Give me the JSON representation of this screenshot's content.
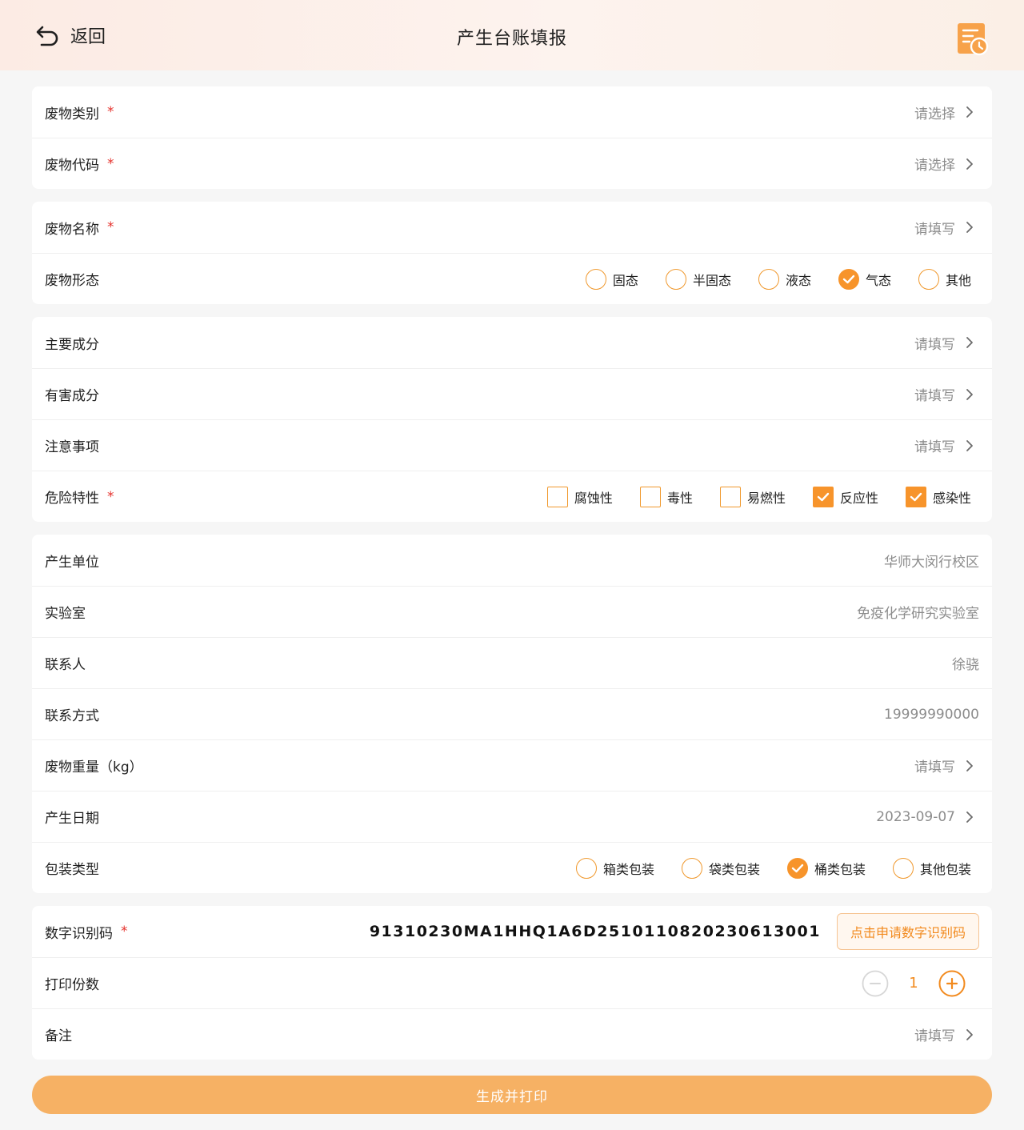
{
  "header": {
    "back_label": "返回",
    "title": "产生台账填报",
    "history_icon": "history-icon"
  },
  "group1": {
    "category": {
      "label": "废物类别",
      "required": "*",
      "placeholder": "请选择"
    },
    "code": {
      "label": "废物代码",
      "required": "*",
      "placeholder": "请选择"
    }
  },
  "group2": {
    "name": {
      "label": "废物名称",
      "required": "*",
      "placeholder": "请填写"
    },
    "form": {
      "label": "废物形态",
      "options": [
        {
          "label": "固态",
          "checked": false
        },
        {
          "label": "半固态",
          "checked": false
        },
        {
          "label": "液态",
          "checked": false
        },
        {
          "label": "气态",
          "checked": true
        },
        {
          "label": "其他",
          "checked": false
        }
      ]
    }
  },
  "group3": {
    "main_components": {
      "label": "主要成分",
      "placeholder": "请填写"
    },
    "harmful_components": {
      "label": "有害成分",
      "placeholder": "请填写"
    },
    "notes": {
      "label": "注意事项",
      "placeholder": "请填写"
    },
    "hazard": {
      "label": "危险特性",
      "required": "*",
      "options": [
        {
          "label": "腐蚀性",
          "checked": false
        },
        {
          "label": "毒性",
          "checked": false
        },
        {
          "label": "易燃性",
          "checked": false
        },
        {
          "label": "反应性",
          "checked": true
        },
        {
          "label": "感染性",
          "checked": true
        }
      ]
    }
  },
  "group4": {
    "unit": {
      "label": "产生单位",
      "value": "华师大闵行校区"
    },
    "lab": {
      "label": "实验室",
      "value": "免疫化学研究实验室"
    },
    "contact": {
      "label": "联系人",
      "value": "徐骁"
    },
    "phone": {
      "label": "联系方式",
      "value": "19999990000"
    },
    "weight": {
      "label": "废物重量（kg）",
      "placeholder": "请填写"
    },
    "date": {
      "label": "产生日期",
      "value": "2023-09-07"
    },
    "package": {
      "label": "包装类型",
      "options": [
        {
          "label": "箱类包装",
          "checked": false
        },
        {
          "label": "袋类包装",
          "checked": false
        },
        {
          "label": "桶类包装",
          "checked": true
        },
        {
          "label": "其他包装",
          "checked": false
        }
      ]
    }
  },
  "group5": {
    "digital_code": {
      "label": "数字识别码",
      "required": "*",
      "value": "91310230MA1HHQ1A6D2510110820230613001",
      "apply_label": "点击申请数字识别码"
    },
    "copies": {
      "label": "打印份数",
      "value": "1"
    },
    "remark": {
      "label": "备注",
      "placeholder": "请填写"
    }
  },
  "submit_label": "生成并打印",
  "colors": {
    "accent": "#f7942b",
    "required": "#e5322d",
    "submit_bg": "#f6b164"
  }
}
